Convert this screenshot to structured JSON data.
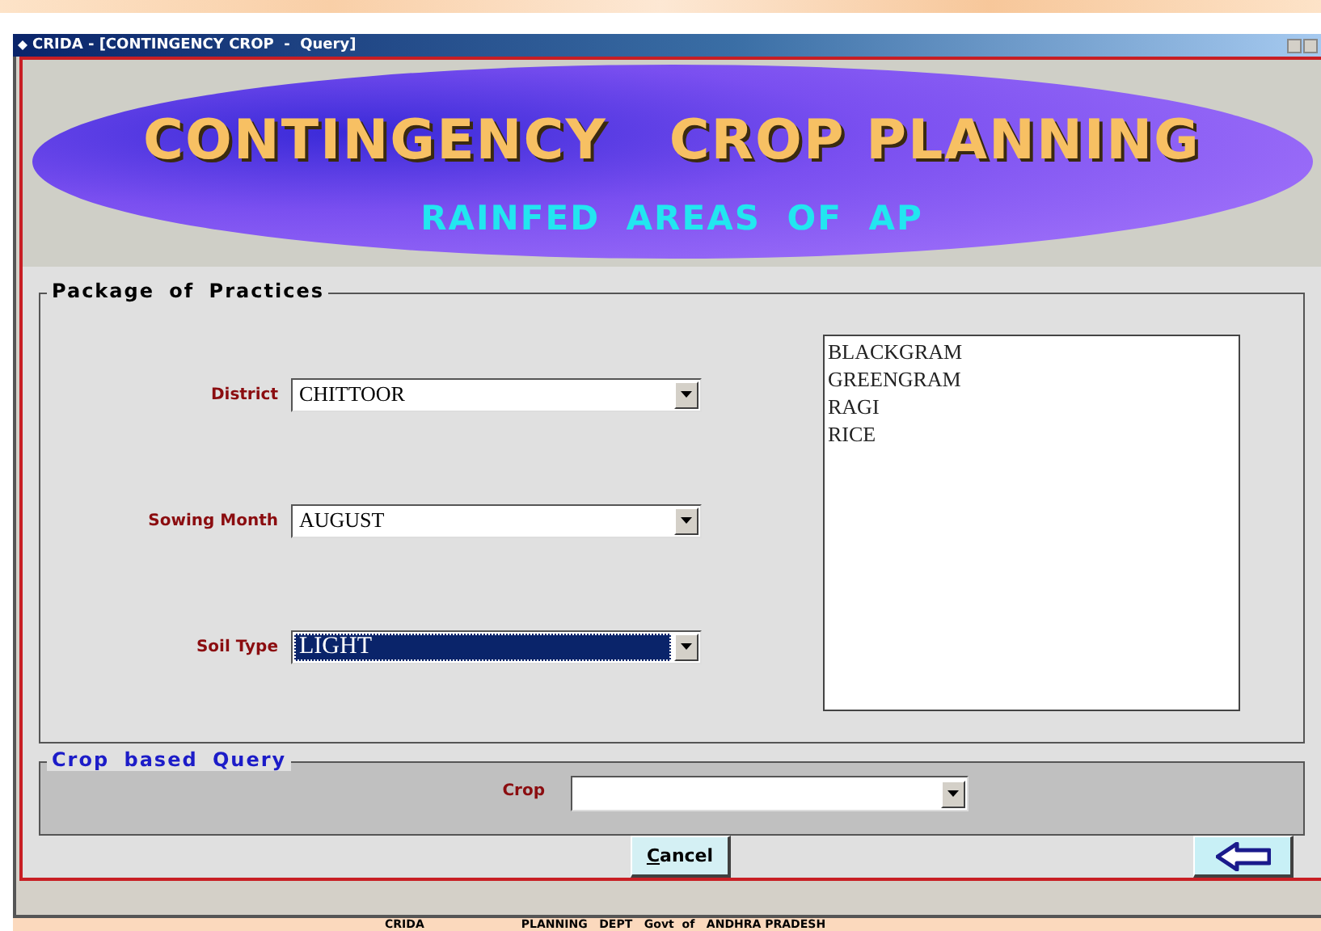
{
  "window": {
    "title": "CRIDA - [CONTINGENCY CROP  -  Query]"
  },
  "banner": {
    "title": "CONTINGENCY   CROP PLANNING",
    "subtitle": "RAINFED AREAS OF AP"
  },
  "package_of_practices": {
    "legend": "Package of Practices",
    "fields": [
      {
        "label": "District",
        "value": "CHITTOOR",
        "focused": false
      },
      {
        "label": "Sowing Month",
        "value": "AUGUST",
        "focused": false
      },
      {
        "label": "Soil Type",
        "value": "LIGHT",
        "focused": true
      }
    ],
    "crop_list": [
      {
        "label": "BLACKGRAM",
        "selected": false
      },
      {
        "label": "GREENGRAM",
        "selected": false
      },
      {
        "label": "RAGI",
        "selected": false
      },
      {
        "label": "RICE",
        "selected": false
      }
    ]
  },
  "crop_query": {
    "legend": "Crop based Query",
    "crop_label": "Crop"
  },
  "buttons": {
    "cancel": "Cancel"
  },
  "status_bar": [
    "CRIDA",
    "PLANNING   DEPT   Govt  of   ANDHRA PRADESH"
  ]
}
